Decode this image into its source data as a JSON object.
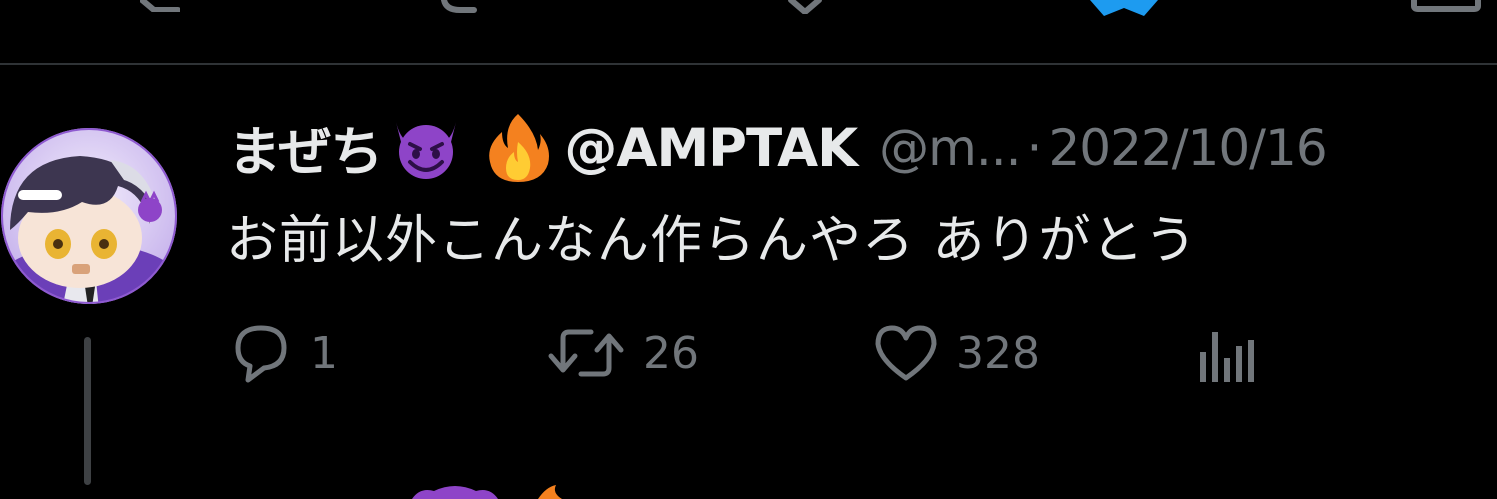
{
  "previous_tweet": {
    "action_icons": [
      "reply-icon",
      "retweet-icon",
      "like-icon",
      "bookmark-icon",
      "share-icon"
    ],
    "bookmark_color": "#1d9bf0"
  },
  "tweet": {
    "display_name": "まぜち",
    "name_emojis": [
      "smiling-imp-emoji",
      "fire-emoji"
    ],
    "name_suffix": "@AMPTAK",
    "handle": "@m...",
    "separator": "·",
    "timestamp": "2022/10/16",
    "text": "お前以外こんなん作らんやろ ありがとう",
    "stats": {
      "replies": "1",
      "retweets": "26",
      "likes": "328"
    }
  },
  "colors": {
    "background": "#000000",
    "text_primary": "#e7e9ea",
    "text_secondary": "#71767b",
    "divider": "#2f3336",
    "thread_line": "#3e4144",
    "emoji_purple": "#8e44c8",
    "fire_orange": "#f4811f"
  }
}
